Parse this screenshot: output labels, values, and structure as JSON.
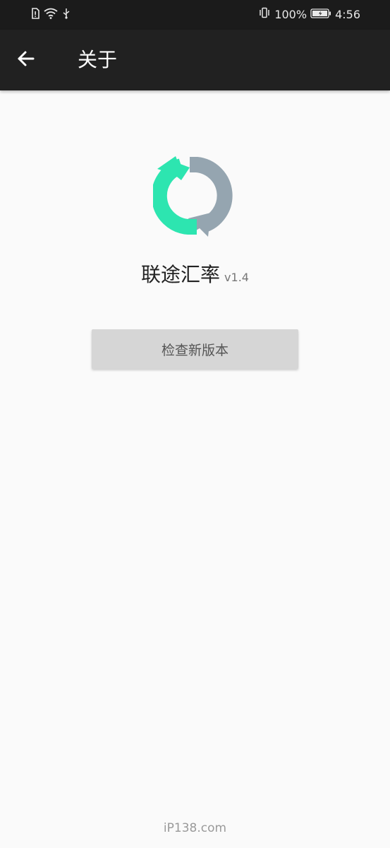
{
  "status_bar": {
    "battery_percent": "100%",
    "time": "4:56",
    "icons": [
      "sim-icon",
      "wifi-icon",
      "usb-icon",
      "vibrate-icon",
      "battery-icon"
    ]
  },
  "app_bar": {
    "title": "关于",
    "back_icon": "arrow-left-icon"
  },
  "about": {
    "app_name": "联途汇率",
    "version": "v1.4",
    "logo_icon": "sync-arrows-icon",
    "logo_colors": [
      "#2de5b0",
      "#95a5b0"
    ],
    "check_update_label": "检查新版本"
  },
  "watermark": "iP138.com",
  "colors": {
    "status_bar_bg": "#1b1b1b",
    "app_bar_bg": "#212121",
    "page_bg": "#fafafa",
    "button_bg": "#d6d6d6"
  }
}
